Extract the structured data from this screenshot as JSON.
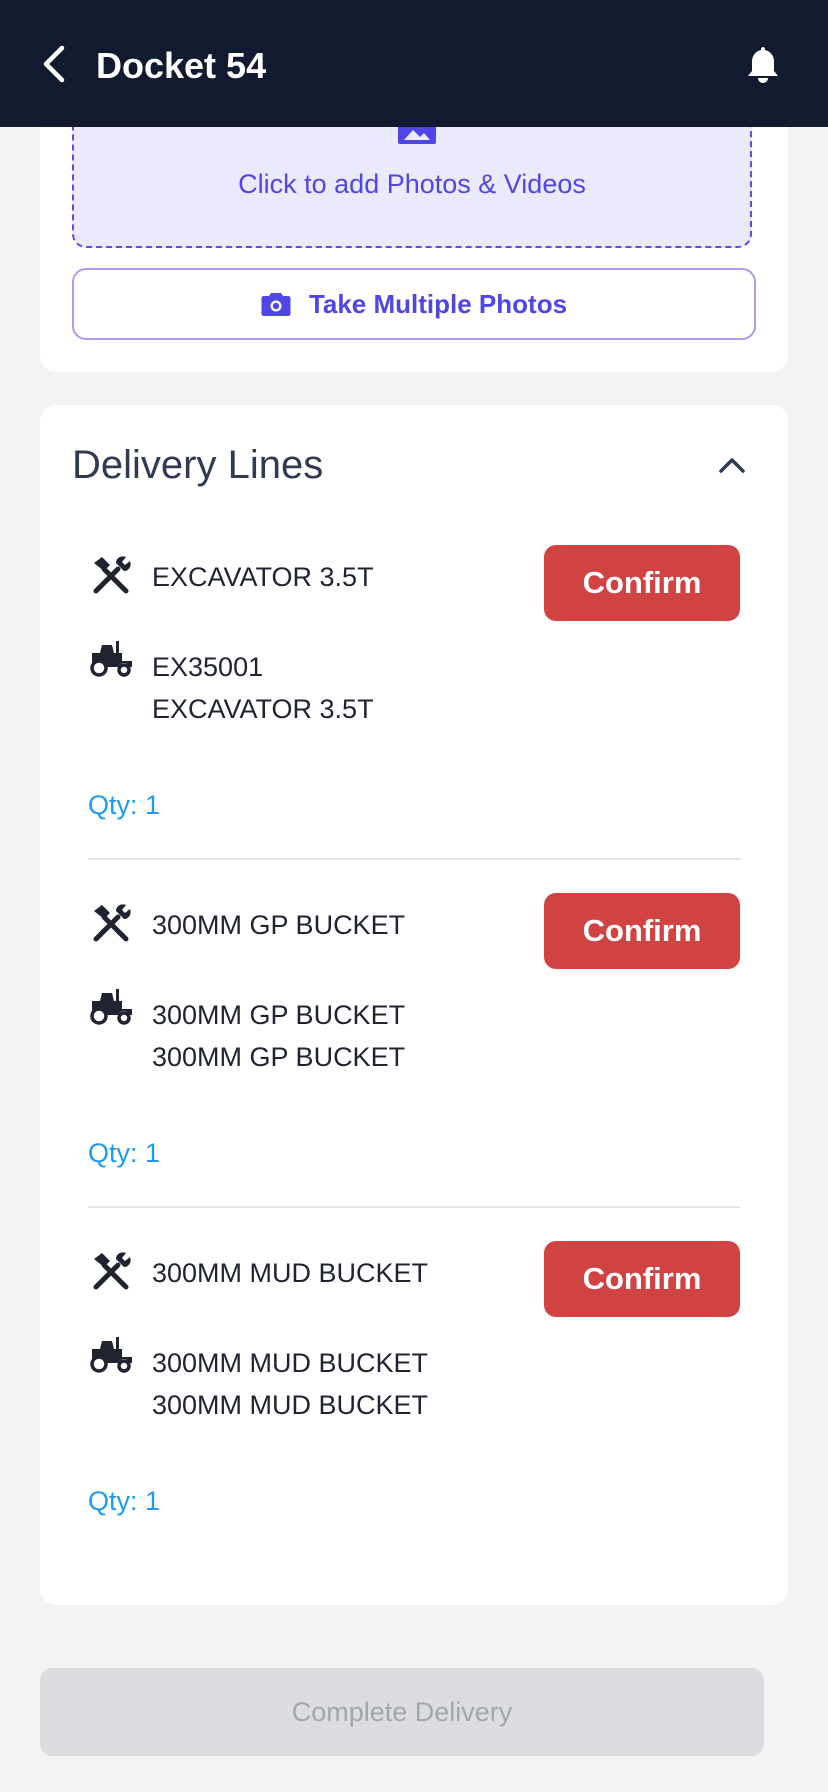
{
  "header": {
    "title": "Docket 54",
    "back_icon": "chevron-left-icon",
    "bell_icon": "bell-icon"
  },
  "upload": {
    "dropzone_text": "Click to add Photos & Videos",
    "take_photos_label": "Take Multiple Photos"
  },
  "delivery_lines": {
    "title": "Delivery Lines",
    "items": [
      {
        "product": "EXCAVATOR 3.5T",
        "asset_code": "EX35001",
        "asset_desc": "EXCAVATOR 3.5T",
        "qty": "Qty: 1",
        "confirm_label": "Confirm"
      },
      {
        "product": "300MM GP BUCKET",
        "asset_code": "300MM GP BUCKET",
        "asset_desc": "300MM GP BUCKET",
        "qty": "Qty: 1",
        "confirm_label": "Confirm"
      },
      {
        "product": "300MM MUD BUCKET",
        "asset_code": "300MM MUD BUCKET",
        "asset_desc": "300MM MUD BUCKET",
        "qty": "Qty: 1",
        "confirm_label": "Confirm"
      }
    ]
  },
  "footer": {
    "complete_label": "Complete Delivery"
  },
  "colors": {
    "header_bg": "#111a2e",
    "accent": "#4f46e5",
    "confirm": "#d14343",
    "qty": "#1e9bef",
    "disabled_bg": "#dcdde0"
  }
}
